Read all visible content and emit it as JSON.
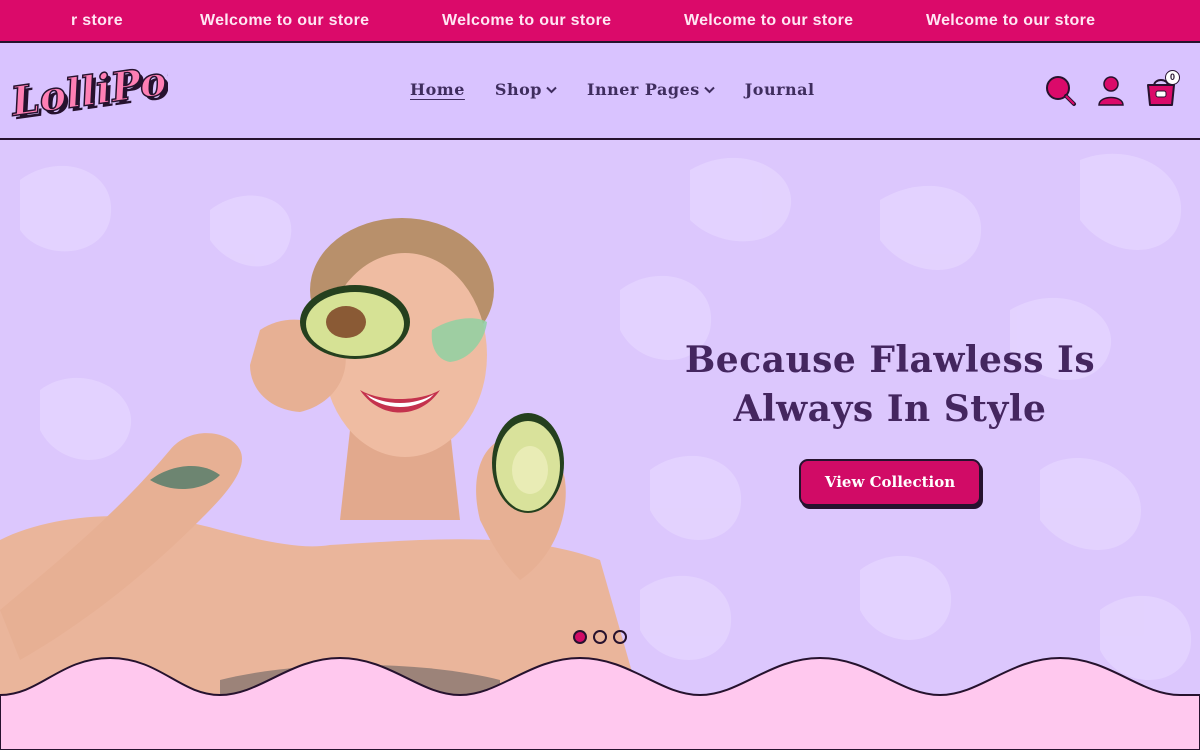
{
  "announcement": {
    "messages": [
      "r store",
      "Welcome to our store",
      "Welcome to our store",
      "Welcome to our store",
      "Welcome to our store"
    ]
  },
  "header": {
    "logo_text": "LolliPop",
    "nav": [
      {
        "label": "Home",
        "active": true,
        "has_dropdown": false
      },
      {
        "label": "Shop",
        "active": false,
        "has_dropdown": true
      },
      {
        "label": "Inner Pages",
        "active": false,
        "has_dropdown": true
      },
      {
        "label": "Journal",
        "active": false,
        "has_dropdown": false
      }
    ],
    "icons": [
      "search-icon",
      "account-icon",
      "cart-icon"
    ],
    "cart_count": "0"
  },
  "hero": {
    "title_line1": "Because Flawless Is",
    "title_line2": "Always In Style",
    "button_label": "View Collection",
    "slide_count": 3,
    "active_slide": 1
  },
  "colors": {
    "announcement_bg": "#db0a6a",
    "header_bg": "#d9c3ff",
    "hero_bg": "#dcc7fd",
    "accent": "#d10b66",
    "heading": "#44265f",
    "footer_wave": "#ffc8ee",
    "outline": "#26122e"
  }
}
